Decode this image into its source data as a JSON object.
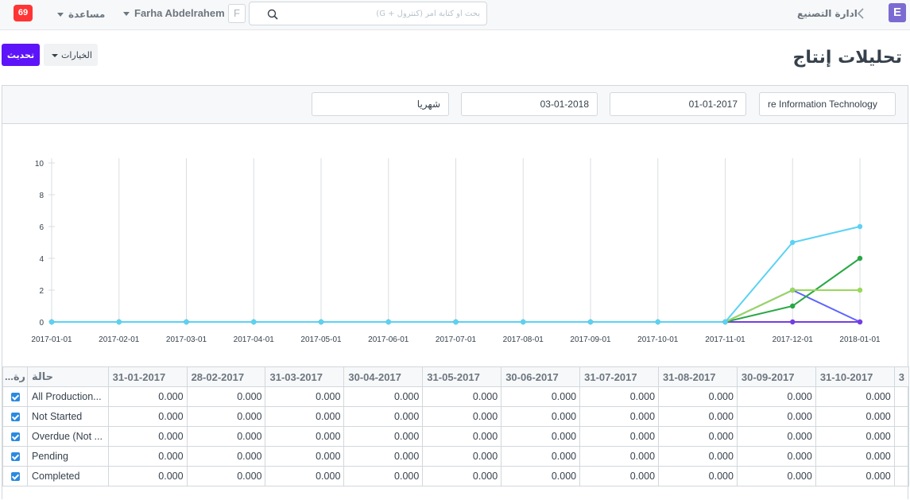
{
  "navbar": {
    "notification_count": "69",
    "help_label": "مساعدة",
    "user_name": "Farha Abdelrahem",
    "avatar_letter": "F",
    "search_placeholder": "بحث أو كتابة أمر (كنترول + G)",
    "breadcrumb": "ادارة التصنيع",
    "app_letter": "E"
  },
  "page": {
    "title": "تحليلات إنتاج",
    "refresh_label": "تحديث",
    "options_label": "الخيارات"
  },
  "filters": {
    "company": "re Information Technology",
    "from_date": "01-01-2017",
    "to_date": "03-01-2018",
    "range": "شهريا"
  },
  "chart_data": {
    "type": "line",
    "x": [
      "2017-01-01",
      "2017-02-01",
      "2017-03-01",
      "2017-04-01",
      "2017-05-01",
      "2017-06-01",
      "2017-07-01",
      "2017-08-01",
      "2017-09-01",
      "2017-10-01",
      "2017-11-01",
      "2017-12-01",
      "2018-01-01"
    ],
    "ylim": [
      0,
      10
    ],
    "yticks": [
      0,
      2,
      4,
      6,
      8,
      10
    ],
    "grid": true,
    "series": [
      {
        "color": "#5e64ff",
        "values": [
          0,
          0,
          0,
          0,
          0,
          0,
          0,
          0,
          0,
          0,
          0,
          2,
          0
        ]
      },
      {
        "color": "#743ee2",
        "values": [
          0,
          0,
          0,
          0,
          0,
          0,
          0,
          0,
          0,
          0,
          0,
          0,
          0
        ]
      },
      {
        "color": "#28a745",
        "values": [
          0,
          0,
          0,
          0,
          0,
          0,
          0,
          0,
          0,
          0,
          0,
          1,
          4
        ]
      },
      {
        "color": "#98d85b",
        "values": [
          0,
          0,
          0,
          0,
          0,
          0,
          0,
          0,
          0,
          0,
          0,
          2,
          2
        ]
      },
      {
        "color": "#5bd2f4",
        "values": [
          0,
          0,
          0,
          0,
          0,
          0,
          0,
          0,
          0,
          0,
          0,
          5,
          6
        ]
      }
    ]
  },
  "table": {
    "headers": [
      "حالة",
      "31-01-2017",
      "28-02-2017",
      "31-03-2017",
      "30-04-2017",
      "31-05-2017",
      "30-06-2017",
      "31-07-2017",
      "31-08-2017",
      "30-09-2017",
      "31-10-2017",
      "3"
    ],
    "corner_header": "...رة",
    "rows": [
      {
        "status": "All Production...",
        "values": [
          "0.000",
          "0.000",
          "0.000",
          "0.000",
          "0.000",
          "0.000",
          "0.000",
          "0.000",
          "0.000",
          "0.000"
        ]
      },
      {
        "status": "Not Started",
        "values": [
          "0.000",
          "0.000",
          "0.000",
          "0.000",
          "0.000",
          "0.000",
          "0.000",
          "0.000",
          "0.000",
          "0.000"
        ]
      },
      {
        "status": "Overdue (Not ...",
        "values": [
          "0.000",
          "0.000",
          "0.000",
          "0.000",
          "0.000",
          "0.000",
          "0.000",
          "0.000",
          "0.000",
          "0.000"
        ]
      },
      {
        "status": "Pending",
        "values": [
          "0.000",
          "0.000",
          "0.000",
          "0.000",
          "0.000",
          "0.000",
          "0.000",
          "0.000",
          "0.000",
          "0.000"
        ]
      },
      {
        "status": "Completed",
        "values": [
          "0.000",
          "0.000",
          "0.000",
          "0.000",
          "0.000",
          "0.000",
          "0.000",
          "0.000",
          "0.000",
          "0.000"
        ]
      }
    ]
  }
}
